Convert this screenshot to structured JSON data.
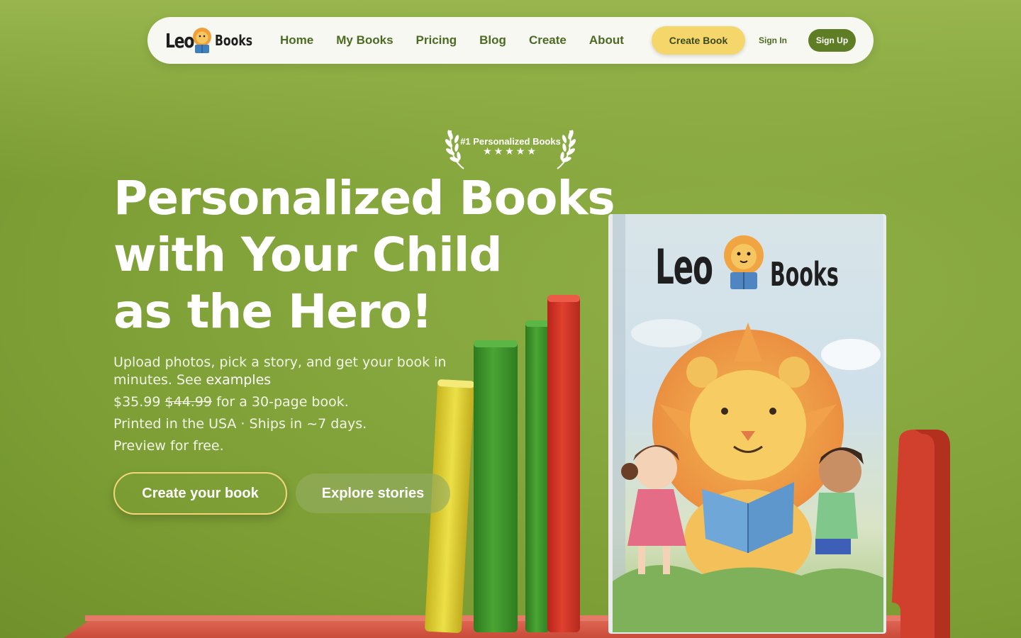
{
  "brand": {
    "leo": "Leo",
    "books": "Books"
  },
  "nav": {
    "items": [
      "Home",
      "My Books",
      "Pricing",
      "Blog",
      "Create",
      "About"
    ],
    "create_book": "Create Book",
    "sign_in": "Sign In",
    "sign_up": "Sign Up"
  },
  "badge": {
    "text": "#1 Personalized Books",
    "stars": "★★★★★",
    "rating": 5
  },
  "hero": {
    "title_lines": [
      "Personalized Books",
      "with Your Child",
      "as the Hero!"
    ],
    "upload_text": "Upload photos, pick a story, and get your book in minutes. See",
    "examples_link": "examples",
    "price": "$35.99",
    "old_price": "$44.99",
    "price_suffix": "for a 30-page book.",
    "shipping": "Printed in the USA · Ships in ~7 days.",
    "preview": "Preview for free.",
    "cta_primary": "Create your book",
    "cta_secondary": "Explore stories"
  },
  "cover": {
    "leo": "Leo",
    "books": "Books"
  },
  "colors": {
    "background": "#84a33b",
    "accent_yellow": "#f4d66b",
    "nav_text": "#4d6a22",
    "signup_bg": "#5f7d25",
    "book_red": "#d3342a",
    "book_green": "#3f8f2a",
    "book_yellow": "#e2cf2e"
  }
}
